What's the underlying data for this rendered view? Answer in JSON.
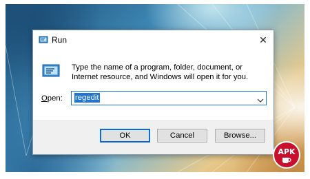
{
  "dialog": {
    "title": "Run",
    "close_glyph": "✕",
    "description": "Type the name of a program, folder, document, or Internet resource, and Windows will open it for you.",
    "open_label_prefix": "",
    "open_label_access_key": "O",
    "open_label_rest": "pen:",
    "open_value": "regedit",
    "buttons": {
      "ok": "OK",
      "cancel": "Cancel",
      "browse": "Browse..."
    }
  },
  "watermark": {
    "text": "APK"
  },
  "colors": {
    "accent": "#1a73d9",
    "selection": "#1f74d6",
    "footer": "#f0f0f0",
    "badge": "#c8102e"
  },
  "icons": [
    "run-app-icon",
    "run-large-icon",
    "close-icon",
    "chevron-down-icon",
    "apk-badge-logo"
  ]
}
